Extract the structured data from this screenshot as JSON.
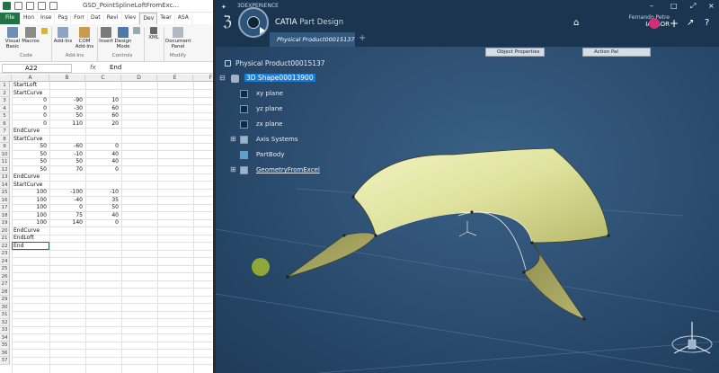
{
  "excel": {
    "title": "GSD_PointSplineLoftFromExc...",
    "tabs": [
      "File",
      "Hon",
      "Inse",
      "Pag",
      "Forr",
      "Dat",
      "Revi",
      "Viev",
      "Dev",
      "Tear",
      "ASA"
    ],
    "active_tab": "Dev",
    "ribbon": {
      "buttons": [
        "Visual Basic",
        "Macros",
        "Add-Ins",
        "COM Add-Ins",
        "Insert",
        "Design Mode",
        "XML",
        "Document Panel"
      ],
      "groups": [
        "Code",
        "Add-Ins",
        "Controls",
        "Modify"
      ]
    },
    "name_box": "A22",
    "fx": "fx",
    "formula_value": "End",
    "columns": [
      "A",
      "B",
      "C",
      "D",
      "E",
      "F"
    ],
    "rows": [
      [
        "StartLoft",
        "",
        ""
      ],
      [
        "StartCurve",
        "",
        ""
      ],
      [
        "0",
        "-90",
        "10"
      ],
      [
        "0",
        "-30",
        "60"
      ],
      [
        "0",
        "50",
        "60"
      ],
      [
        "0",
        "110",
        "20"
      ],
      [
        "EndCurve",
        "",
        ""
      ],
      [
        "StartCurve",
        "",
        ""
      ],
      [
        "50",
        "-60",
        "0"
      ],
      [
        "50",
        "-10",
        "40"
      ],
      [
        "50",
        "50",
        "40"
      ],
      [
        "50",
        "70",
        "0"
      ],
      [
        "EndCurve",
        "",
        ""
      ],
      [
        "StartCurve",
        "",
        ""
      ],
      [
        "100",
        "-100",
        "-10"
      ],
      [
        "100",
        "-40",
        "35"
      ],
      [
        "100",
        "0",
        "50"
      ],
      [
        "100",
        "75",
        "40"
      ],
      [
        "100",
        "140",
        "0"
      ],
      [
        "EndCurve",
        "",
        ""
      ],
      [
        "EndLoft",
        "",
        ""
      ],
      [
        "End",
        "",
        ""
      ]
    ],
    "total_rows": 37
  },
  "catia": {
    "window_title": "3DEXPERIENCE",
    "brand": "CATIA",
    "app": "Part Design",
    "doc_tab": "Physical Product00015137",
    "user_name": "Fernando Petre",
    "user_role": "IARBOR",
    "panel_object_props": "Object Properties",
    "panel_action": "Action Pal",
    "tree": {
      "root": "Physical Product00015137",
      "shape": "3D Shape00013900",
      "items": [
        "xy plane",
        "yz plane",
        "zx plane",
        "Axis Systems",
        "PartBody",
        "GeometryFromExcel"
      ]
    },
    "colors": {
      "background": "#2a4a6a",
      "surface": "#e3e5a4",
      "selection": "#1f7bd0"
    }
  }
}
